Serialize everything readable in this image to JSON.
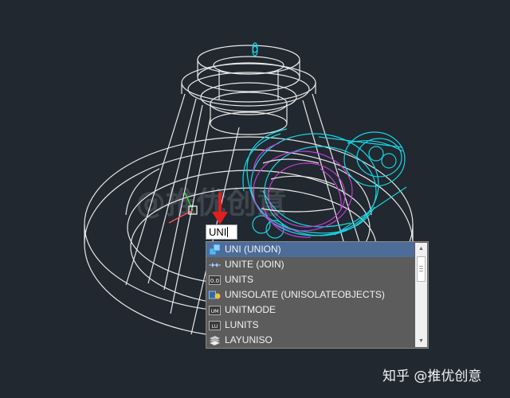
{
  "command_line": {
    "value": "UNI"
  },
  "autocomplete": {
    "items": [
      {
        "label": "UNI (UNION)",
        "icon": "union-icon",
        "selected": true
      },
      {
        "label": "UNITE (JOIN)",
        "icon": "join-icon",
        "selected": false
      },
      {
        "label": "UNITS",
        "icon": "units-icon",
        "selected": false
      },
      {
        "label": "UNISOLATE (UNISOLATEOBJECTS)",
        "icon": "unisolate-icon",
        "selected": false
      },
      {
        "label": "UNITMODE",
        "icon": "unitmode-icon",
        "selected": false
      },
      {
        "label": "LUNITS",
        "icon": "lunits-icon",
        "selected": false
      },
      {
        "label": "LAYUNISO",
        "icon": "layuniso-icon",
        "selected": false
      }
    ]
  },
  "icons": {
    "units_text": "0.0",
    "unitmode_text": "UM",
    "lunits_text": "LU"
  },
  "watermark": {
    "text": "知乎 @推优创意"
  },
  "colors": {
    "background": "#212830",
    "wireframe": "#e8e8e8",
    "cyan": "#19d3e0",
    "magenta": "#c040d0",
    "selected_row": "#4d6d99",
    "arrow": "#e02020"
  }
}
